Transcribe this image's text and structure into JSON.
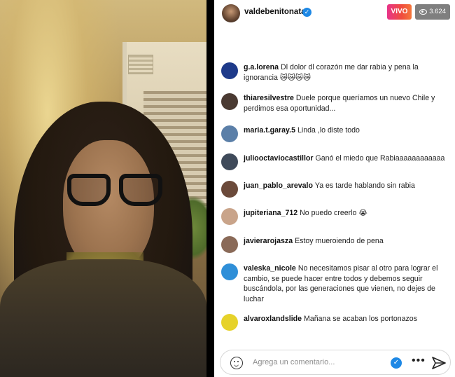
{
  "header": {
    "username": "valdebenitonata",
    "verified_mark": "✓",
    "live_label": "VIVO",
    "viewer_count": "3.624",
    "icons": {
      "verified": "verified-badge-icon",
      "viewers": "eye-icon"
    }
  },
  "comments": [
    {
      "user": "g.a.lorena",
      "text": "Dl dolor dl corazón me dar rabia y pena la ignorancia 😿😿😿😿",
      "avatar_color": "#1e3a8a"
    },
    {
      "user": "thiaresilvestre",
      "text": "Duele porque queríamos un nuevo Chile y perdimos esa oportunidad...",
      "avatar_color": "#4a3a32"
    },
    {
      "user": "maria.t.garay.5",
      "text": "Linda ,lo diste todo",
      "avatar_color": "#5b7fa8"
    },
    {
      "user": "juliooctaviocastillor",
      "text": "Ganó el miedo que Rabiaaaaaaaaaaaa",
      "avatar_color": "#3f4a5a"
    },
    {
      "user": "juan_pablo_arevalo",
      "text": "Ya es tarde hablando sin rabia",
      "avatar_color": "#6b4a3a"
    },
    {
      "user": "jupiteriana_712",
      "text": "No puedo creerlo 😭",
      "avatar_color": "#c9a48a"
    },
    {
      "user": "javierarojasza",
      "text": "Estoy mueroiendo de pena",
      "avatar_color": "#8a6a58"
    },
    {
      "user": "valeska_nicole",
      "text": "No necesitamos pisar al otro para lograr el cambio, se puede hacer entre todos y debemos seguir buscándola, por las generaciones que vienen, no dejes de luchar",
      "avatar_color": "#2f8fd8"
    },
    {
      "user": "alvaroxlandslide",
      "text": "Mañana se acaban los portonazos",
      "avatar_color": "#e6d22a"
    }
  ],
  "composer": {
    "placeholder": "Agrega un comentario...",
    "badge_mark": "✓",
    "more_label": "•••",
    "icons": [
      "emoji-icon",
      "verified-badge-icon",
      "more-icon",
      "send-icon"
    ]
  }
}
